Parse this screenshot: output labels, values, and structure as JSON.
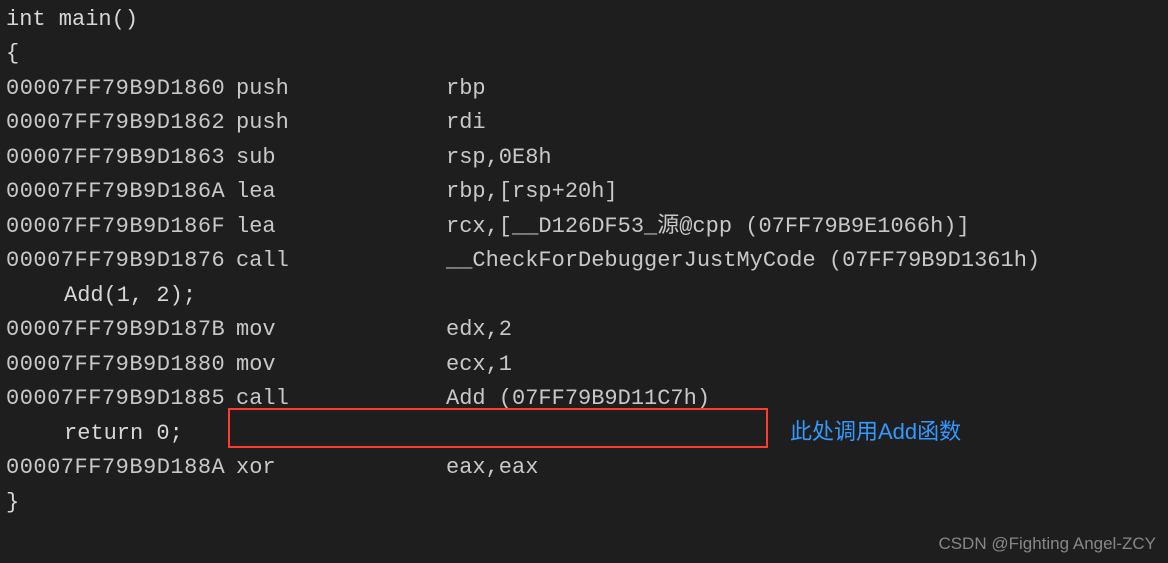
{
  "src": {
    "decl": "int main()",
    "open": "{",
    "call": "Add(1, 2);",
    "ret": "return 0;",
    "close": "}"
  },
  "asm": [
    {
      "addr": "00007FF79B9D1860",
      "mn": "push",
      "op": "rbp"
    },
    {
      "addr": "00007FF79B9D1862",
      "mn": "push",
      "op": "rdi"
    },
    {
      "addr": "00007FF79B9D1863",
      "mn": "sub",
      "op": "rsp,0E8h"
    },
    {
      "addr": "00007FF79B9D186A",
      "mn": "lea",
      "op": "rbp,[rsp+20h]"
    },
    {
      "addr": "00007FF79B9D186F",
      "mn": "lea",
      "op": "rcx,[__D126DF53_源@cpp (07FF79B9E1066h)]"
    },
    {
      "addr": "00007FF79B9D1876",
      "mn": "call",
      "op": "__CheckForDebuggerJustMyCode (07FF79B9D1361h)"
    },
    {
      "addr": "00007FF79B9D187B",
      "mn": "mov",
      "op": "edx,2"
    },
    {
      "addr": "00007FF79B9D1880",
      "mn": "mov",
      "op": "ecx,1"
    },
    {
      "addr": "00007FF79B9D1885",
      "mn": "call",
      "op": "Add (07FF79B9D11C7h)"
    },
    {
      "addr": "00007FF79B9D188A",
      "mn": "xor",
      "op": "eax,eax"
    }
  ],
  "annotation": "此处调用Add函数",
  "watermark": "CSDN @Fighting Angel-ZCY"
}
